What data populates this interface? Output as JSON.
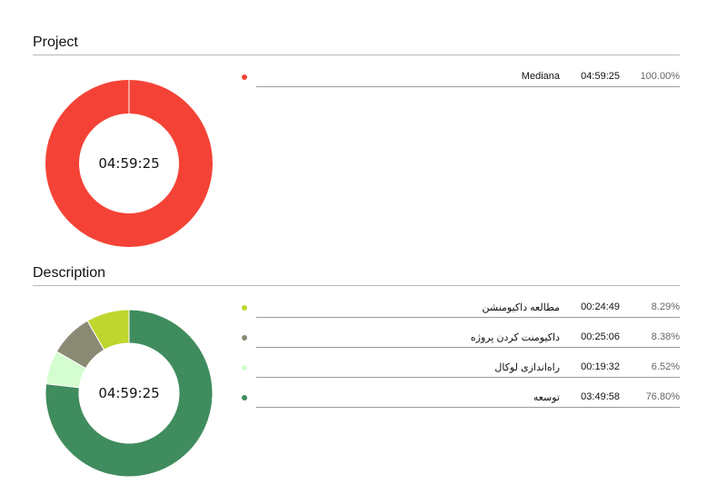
{
  "sections": [
    {
      "title": "Project",
      "center_label": "04:59:25",
      "items": [
        {
          "name": "Mediana",
          "time": "04:59:25",
          "percent": "100.00%",
          "value": 100.0,
          "color": "#f44336"
        }
      ]
    },
    {
      "title": "Description",
      "center_label": "04:59:25",
      "items": [
        {
          "name": "مطالعه داکیومنشن",
          "time": "00:24:49",
          "percent": "8.29%",
          "value": 8.29,
          "color": "#bfd62f"
        },
        {
          "name": "داکیومنت کردن پروژه",
          "time": "00:25:06",
          "percent": "8.38%",
          "value": 8.38,
          "color": "#8a8a74"
        },
        {
          "name": "راه‌اندازی لوکال",
          "time": "00:19:32",
          "percent": "6.52%",
          "value": 6.52,
          "color": "#d4fdd0"
        },
        {
          "name": "توسعه",
          "time": "03:49:58",
          "percent": "76.80%",
          "value": 76.8,
          "color": "#3f8c5e"
        }
      ]
    }
  ],
  "chart_data": [
    {
      "type": "pie",
      "title": "Project",
      "categories": [
        "Mediana"
      ],
      "values": [
        100.0
      ],
      "center_label": "04:59:25"
    },
    {
      "type": "pie",
      "title": "Description",
      "categories": [
        "مطالعه داکیومنشن",
        "داکیومنت کردن پروژه",
        "راه‌اندازی لوکال",
        "توسعه"
      ],
      "values": [
        8.29,
        8.38,
        6.52,
        76.8
      ],
      "center_label": "04:59:25"
    }
  ]
}
